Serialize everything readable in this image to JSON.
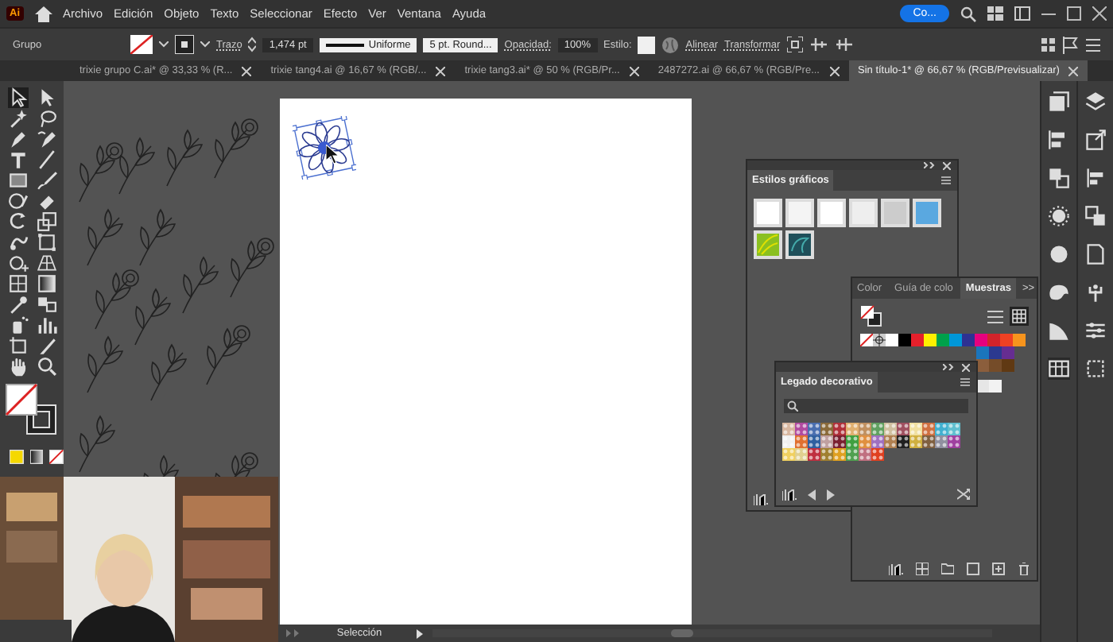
{
  "app_logo": "Ai",
  "menu": [
    "Archivo",
    "Edición",
    "Objeto",
    "Texto",
    "Seleccionar",
    "Efecto",
    "Ver",
    "Ventana",
    "Ayuda"
  ],
  "account_button": "Co...",
  "control_bar": {
    "selection_label": "Grupo",
    "stroke_label": "Trazo",
    "stroke_weight": "1,474 pt",
    "stroke_profile": "Uniforme",
    "brush": "5 pt. Round...",
    "opacity_label": "Opacidad:",
    "opacity_value": "100%",
    "style_label": "Estilo:",
    "align_link": "Alinear",
    "transform_link": "Transformar"
  },
  "tabs": [
    {
      "label": "trixie grupo C.ai* @ 33,33 % (R...",
      "selected": false
    },
    {
      "label": "trixie tang4.ai @ 16,67 % (RGB/...",
      "selected": false
    },
    {
      "label": "trixie tang3.ai* @ 50 % (RGB/Pr...",
      "selected": false
    },
    {
      "label": "2487272.ai @ 66,67 % (RGB/Pre...",
      "selected": false
    },
    {
      "label": "Sin título-1* @ 66,67 % (RGB/Previsualizar)",
      "selected": true
    }
  ],
  "graphic_styles_panel": {
    "title": "Estilos gráficos"
  },
  "swatches_panel": {
    "tabs": [
      {
        "label": "Color",
        "selected": false
      },
      {
        "label": "Guía de colo",
        "selected": false
      },
      {
        "label": "Muestras",
        "selected": true
      }
    ],
    "expand_glyph": ">>",
    "row_1": [
      {
        "color": "#ffffff"
      },
      {
        "color": "#000000"
      },
      {
        "color": "#e5202b"
      },
      {
        "color": "#fff000"
      },
      {
        "color": "#00a14b"
      },
      {
        "color": "#0097d8"
      },
      {
        "color": "#2e3192"
      },
      {
        "color": "#e6007e"
      },
      {
        "color": "#d2232a"
      },
      {
        "color": "#ef4123"
      },
      {
        "color": "#f7941d"
      }
    ],
    "row_2": [
      {
        "color": "#1b75bc"
      },
      {
        "color": "#2b3990"
      },
      {
        "color": "#662d91"
      }
    ],
    "row_3": [
      {
        "color": "#8b5e3c"
      },
      {
        "color": "#754c29"
      },
      {
        "color": "#603913"
      }
    ],
    "row_4": [
      {
        "color": "#e6e6e6"
      },
      {
        "color": "#f2f2f2"
      }
    ]
  },
  "decorative_panel": {
    "title": "Legado decorativo",
    "patterns": [
      {
        "color": "#d8b7a0"
      },
      {
        "color": "#b04aa0"
      },
      {
        "color": "#4a6fb0"
      },
      {
        "color": "#8a6a3a"
      },
      {
        "color": "#b0303a"
      },
      {
        "color": "#e0b070"
      },
      {
        "color": "#c09060"
      },
      {
        "color": "#60a060"
      },
      {
        "color": "#d0c0a0"
      },
      {
        "color": "#a05060"
      },
      {
        "color": "#f0e0a0"
      },
      {
        "color": "#d07040"
      },
      {
        "color": "#40b0d0"
      },
      {
        "color": "#60c0d0"
      },
      {
        "color": "#f0f0f0"
      },
      {
        "color": "#e07030"
      },
      {
        "color": "#3060a0"
      },
      {
        "color": "#c0a0a0"
      },
      {
        "color": "#7a2030"
      },
      {
        "color": "#40a040"
      },
      {
        "color": "#e09040"
      },
      {
        "color": "#a070c0"
      },
      {
        "color": "#b08050"
      },
      {
        "color": "#202020"
      },
      {
        "color": "#d0b040"
      },
      {
        "color": "#806040"
      },
      {
        "color": "#9090a0"
      },
      {
        "color": "#a040a0"
      },
      {
        "color": "#f0d060"
      },
      {
        "color": "#e0d090"
      },
      {
        "color": "#c03040"
      },
      {
        "color": "#a08030"
      },
      {
        "color": "#e0a020"
      },
      {
        "color": "#50a050"
      },
      {
        "color": "#c07080"
      },
      {
        "color": "#e04020"
      }
    ]
  },
  "status_bar": {
    "tool": "Selección"
  }
}
